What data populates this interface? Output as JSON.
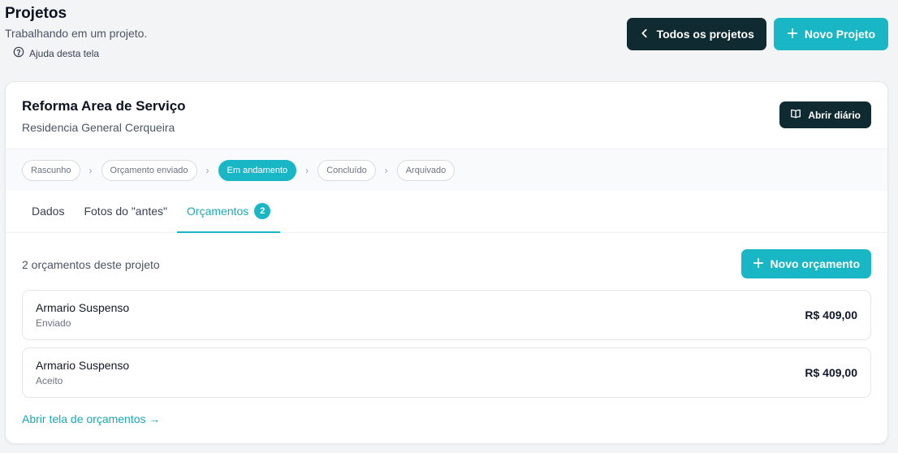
{
  "header": {
    "title": "Projetos",
    "subtitle": "Trabalhando em um projeto.",
    "help": "Ajuda desta tela",
    "all_projects": "Todos os projetos",
    "new_project": "Novo Projeto"
  },
  "project": {
    "name": "Reforma Area de Serviço",
    "client": "Residencia General Cerqueira",
    "open_diary": "Abrir diário"
  },
  "status_steps": [
    {
      "label": "Rascunho",
      "active": false
    },
    {
      "label": "Orçamento enviado",
      "active": false
    },
    {
      "label": "Em andamento",
      "active": true
    },
    {
      "label": "Concluído",
      "active": false
    },
    {
      "label": "Arquivado",
      "active": false
    }
  ],
  "tabs": [
    {
      "label": "Dados"
    },
    {
      "label": "Fotos do \"antes\""
    },
    {
      "label": "Orçamentos",
      "badge": "2",
      "active": true
    }
  ],
  "budgets": {
    "count_text": "2 orçamentos deste projeto",
    "new_budget": "Novo orçamento",
    "items": [
      {
        "name": "Armario Suspenso",
        "status": "Enviado",
        "value": "R$ 409,00"
      },
      {
        "name": "Armario Suspenso",
        "status": "Aceito",
        "value": "R$ 409,00"
      }
    ],
    "open_screen": "Abrir tela de orçamentos →"
  },
  "colors": {
    "accent": "#19b6c6",
    "dark": "#0f2a30"
  }
}
